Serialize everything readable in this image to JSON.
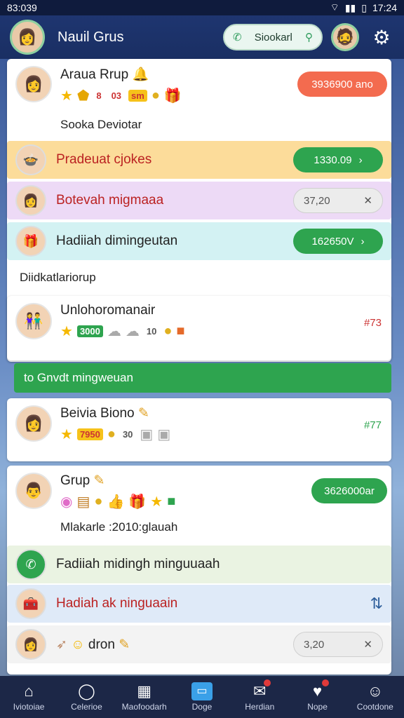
{
  "status": {
    "left": "83:039",
    "right": "17:24"
  },
  "header": {
    "title": "Nauil Grus",
    "search_label": "Siookarl"
  },
  "card1": {
    "name": "Araua Rrup",
    "pill": "3936900 ano",
    "chip1": "03",
    "chip2": "sm",
    "subtitle": "Sooka Deviotar"
  },
  "strips": [
    {
      "label": "Pradeuat cjokes",
      "pill": "1330.09",
      "bg": "#fcdc9a"
    },
    {
      "label": "Botevah migmaaa",
      "pill": "37,20",
      "bg": "#eddaf6"
    },
    {
      "label": "Hadiiah dimingeutan",
      "pill": "162650V",
      "bg": "#d3f2f3"
    }
  ],
  "section_label": "Diidkatlariorup",
  "card2": {
    "name": "Unlohoromanair",
    "chip": "3000",
    "num": "10",
    "val": "#73"
  },
  "green_bar": "to Gnvdt mingweuan",
  "card3": {
    "name": "Beivia Biono",
    "chip": "7950",
    "chip2": "30",
    "val": "#77"
  },
  "card4": {
    "name": "Grup",
    "pill": "3626000ar",
    "subtitle": "Mlakarle :2010:glauah"
  },
  "strips2": [
    {
      "label": "Fadiiah midingh minguuaah",
      "bg": "#eaf3e2"
    },
    {
      "label": "Hadiah ak ninguaain",
      "bg": "#dfeaf8"
    },
    {
      "label": "dron",
      "pill": "3,20",
      "bg": "#f3f3f3"
    }
  ],
  "nav": [
    {
      "label": "Iviotoiae",
      "icon": "home-icon"
    },
    {
      "label": "Celerioe",
      "icon": "chat-icon"
    },
    {
      "label": "Maofoodarh",
      "icon": "grid-icon"
    },
    {
      "label": "Doge",
      "icon": "card-icon"
    },
    {
      "label": "Herdian",
      "icon": "gift-icon"
    },
    {
      "label": "Nope",
      "icon": "heart-icon"
    },
    {
      "label": "Cootdone",
      "icon": "person-icon"
    }
  ]
}
